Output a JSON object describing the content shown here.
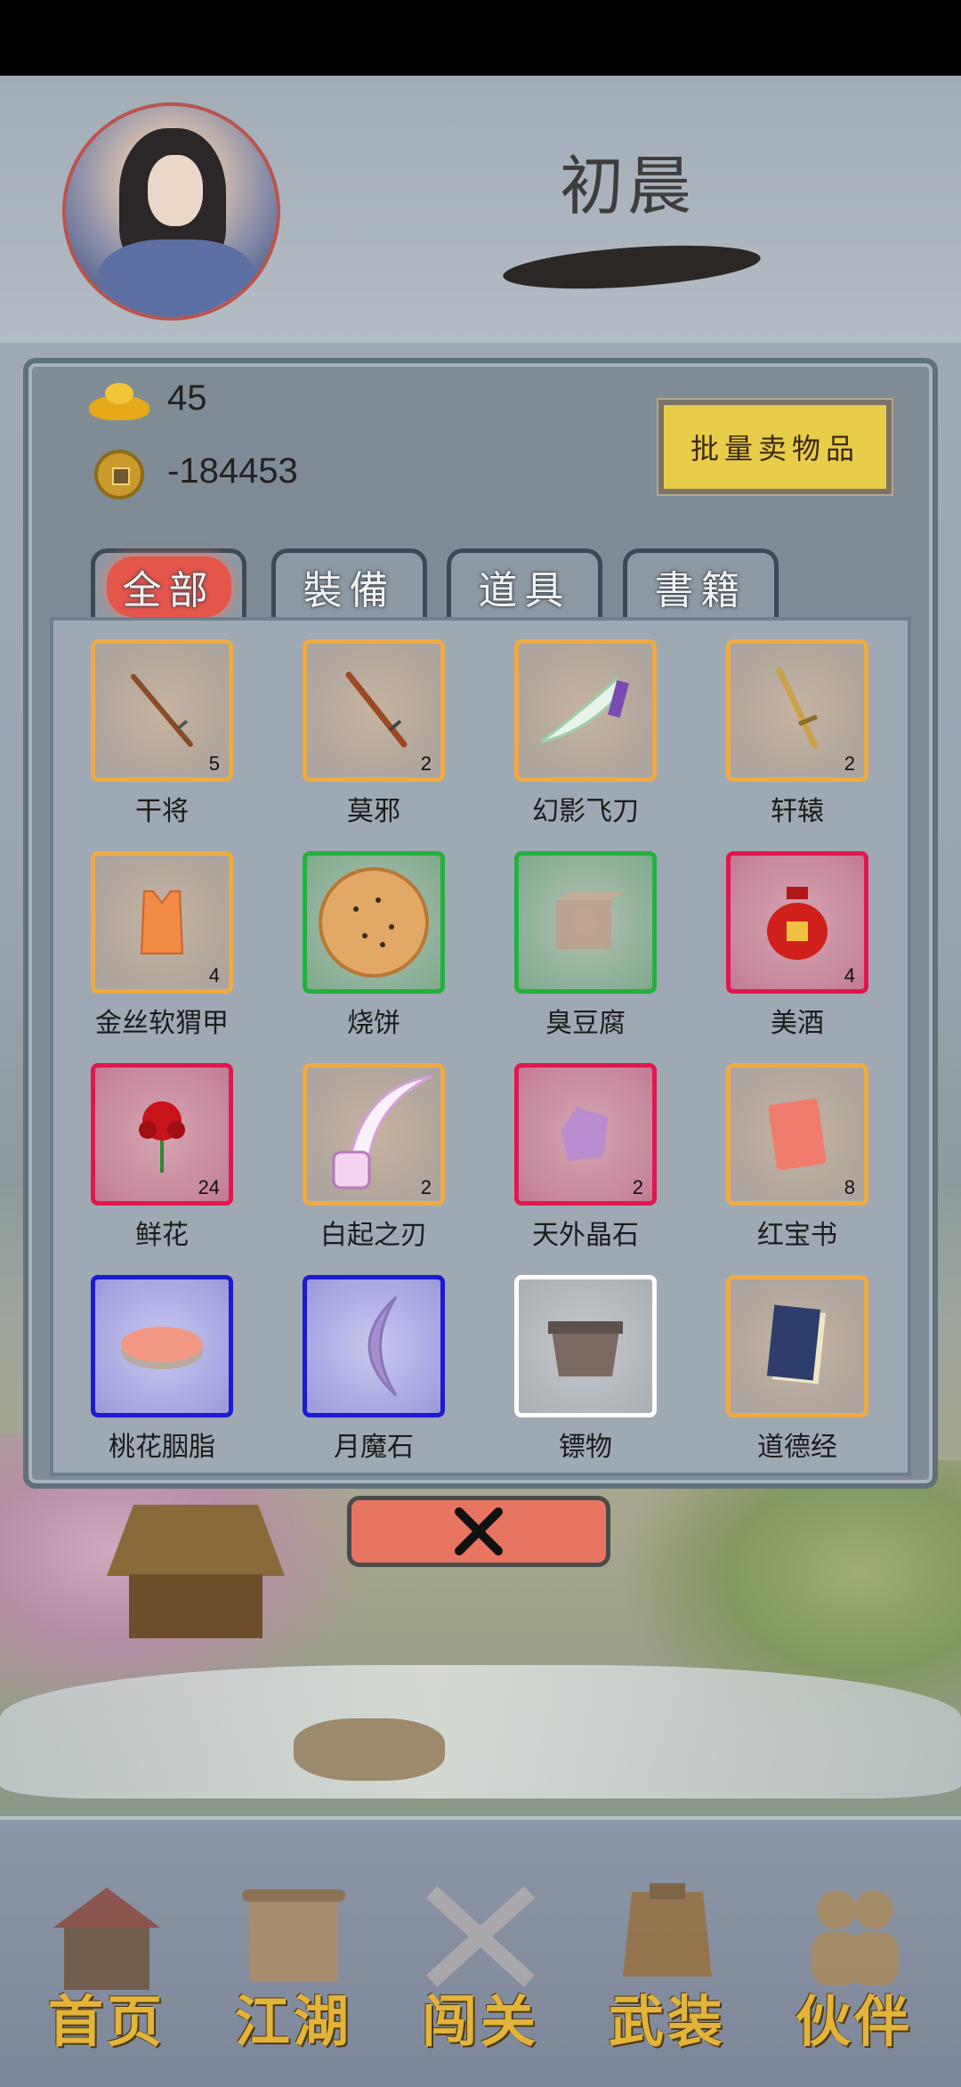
{
  "player": {
    "name": "初晨"
  },
  "currency": {
    "gold": "45",
    "coins": "-184453"
  },
  "sell_button": "批量卖物品",
  "tabs": [
    {
      "label": "全部",
      "active": true
    },
    {
      "label": "裝備",
      "active": false
    },
    {
      "label": "道具",
      "active": false
    },
    {
      "label": "書籍",
      "active": false
    }
  ],
  "items": [
    {
      "name": "干将",
      "count": "5",
      "rarity": "orange",
      "icon": "sword-icon"
    },
    {
      "name": "莫邪",
      "count": "2",
      "rarity": "orange",
      "icon": "sword-icon"
    },
    {
      "name": "幻影飞刀",
      "count": "",
      "rarity": "orange",
      "icon": "flying-knife-icon"
    },
    {
      "name": "轩辕",
      "count": "2",
      "rarity": "orange",
      "icon": "golden-sword-icon"
    },
    {
      "name": "金丝软猬甲",
      "count": "4",
      "rarity": "orange",
      "icon": "vest-armor-icon"
    },
    {
      "name": "烧饼",
      "count": "",
      "rarity": "green",
      "icon": "flatbread-icon"
    },
    {
      "name": "臭豆腐",
      "count": "",
      "rarity": "green",
      "icon": "tofu-icon"
    },
    {
      "name": "美酒",
      "count": "4",
      "rarity": "red",
      "icon": "wine-jar-icon"
    },
    {
      "name": "鲜花",
      "count": "24",
      "rarity": "red",
      "icon": "rose-icon"
    },
    {
      "name": "白起之刃",
      "count": "2",
      "rarity": "orange",
      "icon": "curved-blade-icon"
    },
    {
      "name": "天外晶石",
      "count": "2",
      "rarity": "red",
      "icon": "crystal-icon"
    },
    {
      "name": "红宝书",
      "count": "8",
      "rarity": "orange",
      "icon": "red-book-icon"
    },
    {
      "name": "桃花胭脂",
      "count": "",
      "rarity": "blue",
      "icon": "rouge-box-icon"
    },
    {
      "name": "月魔石",
      "count": "",
      "rarity": "blue",
      "icon": "moon-stone-icon"
    },
    {
      "name": "镖物",
      "count": "",
      "rarity": "white",
      "icon": "cargo-chest-icon"
    },
    {
      "name": "道德经",
      "count": "",
      "rarity": "orange",
      "icon": "scripture-book-icon"
    }
  ],
  "close_button_icon": "close-icon",
  "nav": [
    {
      "label": "首页",
      "icon": "house-icon"
    },
    {
      "label": "江湖",
      "icon": "scroll-icon"
    },
    {
      "label": "闯关",
      "icon": "crossed-swords-icon"
    },
    {
      "label": "武装",
      "icon": "armor-icon"
    },
    {
      "label": "伙伴",
      "icon": "partners-icon"
    }
  ]
}
